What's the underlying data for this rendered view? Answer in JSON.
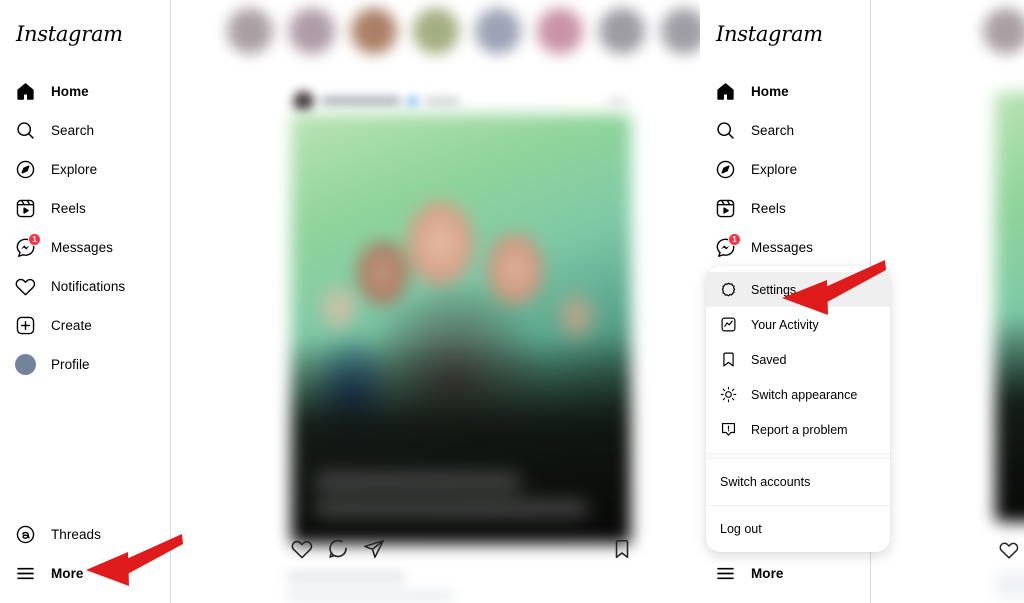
{
  "app": {
    "brand": "Instagram"
  },
  "left_sidebar": {
    "brand": "Instagram",
    "items": [
      {
        "label": "Home",
        "icon": "home-icon",
        "active": true
      },
      {
        "label": "Search",
        "icon": "search-icon",
        "active": false
      },
      {
        "label": "Explore",
        "icon": "compass-icon",
        "active": false
      },
      {
        "label": "Reels",
        "icon": "reels-icon",
        "active": false
      },
      {
        "label": "Messages",
        "icon": "messenger-icon",
        "active": false,
        "badge": "1"
      },
      {
        "label": "Notifications",
        "icon": "heart-icon",
        "active": false
      },
      {
        "label": "Create",
        "icon": "plus-square-icon",
        "active": false
      },
      {
        "label": "Profile",
        "icon": "avatar-icon",
        "active": false
      }
    ],
    "bottom_items": [
      {
        "label": "Threads",
        "icon": "threads-icon"
      },
      {
        "label": "More",
        "icon": "hamburger-icon"
      }
    ]
  },
  "right_sidebar": {
    "brand": "Instagram",
    "items": [
      {
        "label": "Home",
        "icon": "home-icon",
        "active": true
      },
      {
        "label": "Search",
        "icon": "search-icon",
        "active": false
      },
      {
        "label": "Explore",
        "icon": "compass-icon",
        "active": false
      },
      {
        "label": "Reels",
        "icon": "reels-icon",
        "active": false
      },
      {
        "label": "Messages",
        "icon": "messenger-icon",
        "active": false,
        "badge": "1"
      }
    ],
    "bottom_items": [
      {
        "label": "More",
        "icon": "hamburger-icon"
      }
    ]
  },
  "more_menu": {
    "items": [
      {
        "label": "Settings",
        "icon": "gear-icon",
        "highlighted": true
      },
      {
        "label": "Your Activity",
        "icon": "activity-icon",
        "highlighted": false
      },
      {
        "label": "Saved",
        "icon": "bookmark-icon",
        "highlighted": false
      },
      {
        "label": "Switch appearance",
        "icon": "sun-icon",
        "highlighted": false
      },
      {
        "label": "Report a problem",
        "icon": "report-icon",
        "highlighted": false
      }
    ],
    "footer_items": [
      {
        "label": "Switch accounts"
      },
      {
        "label": "Log out"
      }
    ]
  },
  "feed": {
    "post_actions": [
      {
        "name": "like-button",
        "icon": "heart-icon"
      },
      {
        "name": "comment-button",
        "icon": "comment-icon"
      },
      {
        "name": "share-button",
        "icon": "share-icon"
      },
      {
        "name": "save-button",
        "icon": "bookmark-icon"
      }
    ],
    "stories_colors": [
      "#9b8f93",
      "#a08a97",
      "#9d6a4c",
      "#93a06a",
      "#8a93a8",
      "#c08097",
      "#8c8a93",
      "#8f8d95"
    ]
  },
  "annotations": {
    "arrow_color": "#e01b1b",
    "arrows": [
      {
        "name": "arrow-pointing-to-settings",
        "target": "Settings"
      },
      {
        "name": "arrow-pointing-to-more",
        "target": "More"
      }
    ]
  }
}
